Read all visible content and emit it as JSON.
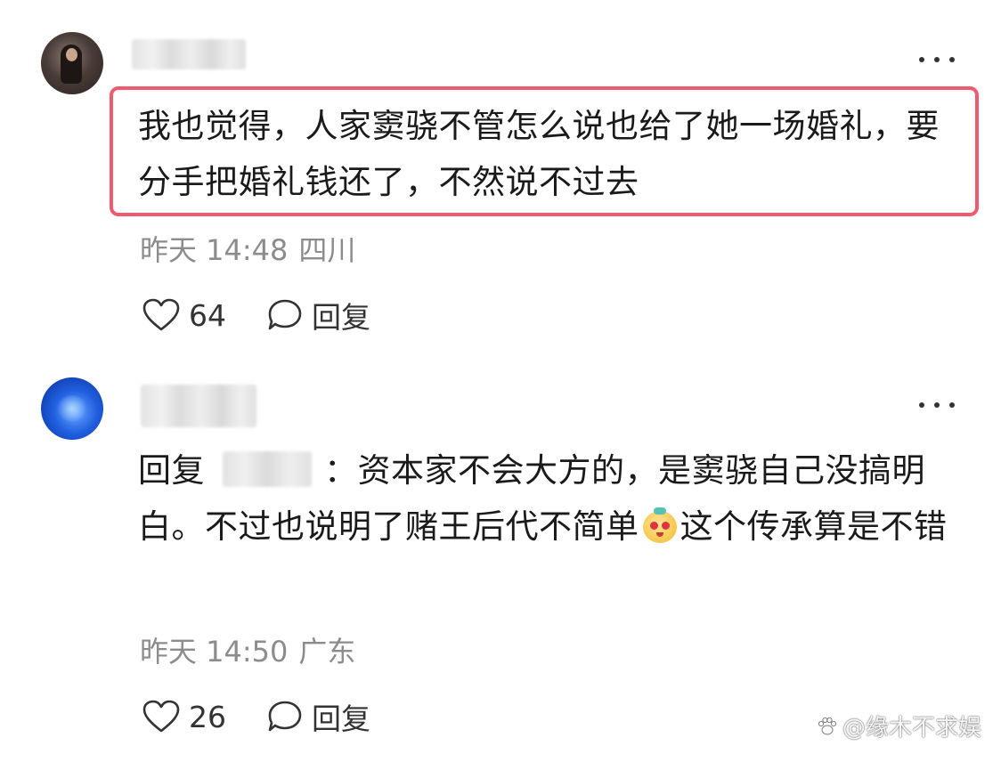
{
  "comments": [
    {
      "text": "我也觉得，人家窦骁不管怎么说也给了她一场婚礼，要分手把婚礼钱还了，不然说不过去",
      "time": "昨天 14:48",
      "location": "四川",
      "likes": "64",
      "reply_label": "回复",
      "highlighted": true,
      "highlight_color": "#f05a6e"
    },
    {
      "reply_prefix": "回复",
      "text_before_emoji": "：资本家不会大方的，是窦骁自己没搞明白。不过也说明了赌王后代不简单",
      "emoji": "smiling-bun-emoji",
      "text_after_emoji": "这个传承算是不错",
      "time": "昨天 14:50",
      "location": "广东",
      "likes": "26",
      "reply_label": "回复"
    }
  ],
  "icons": {
    "more": "more-icon",
    "like": "heart-icon",
    "reply": "comment-bubble-icon"
  },
  "watermark": {
    "text": "@缘木不求娱"
  },
  "colors": {
    "meta_text": "#8c8c8c",
    "body_text": "#1a1a1a"
  }
}
